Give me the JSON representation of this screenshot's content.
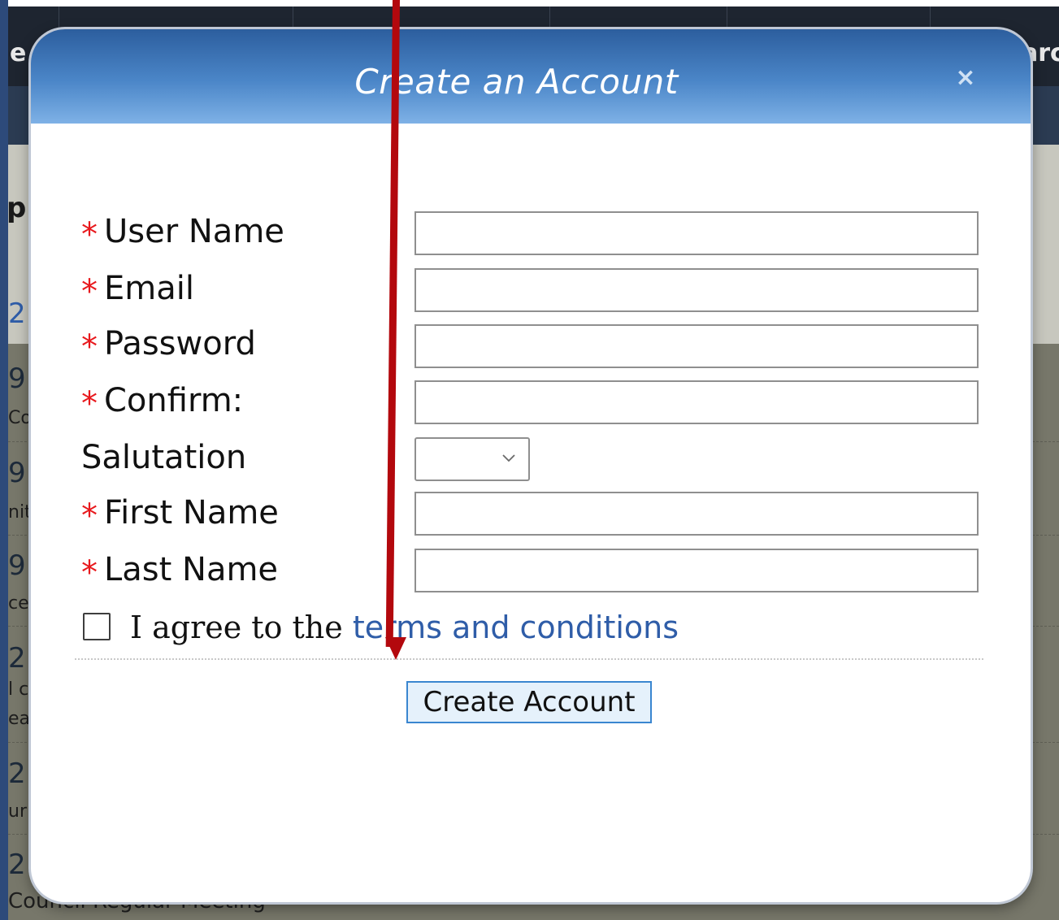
{
  "background": {
    "topbar_text_left": "e",
    "topbar_text_right": "arc",
    "side_chars": [
      "p",
      "2",
      "9",
      "9",
      "9",
      "2",
      "2",
      "2"
    ],
    "side_small": [
      "Co",
      "nit",
      "ce",
      "l c",
      "ea",
      "ur"
    ],
    "footer_text": "Council   Regular Meeting"
  },
  "modal": {
    "title": "Create an Account",
    "close_label": "×",
    "fields": [
      {
        "label": "User Name",
        "required": true,
        "value": ""
      },
      {
        "label": "Email",
        "required": true,
        "value": ""
      },
      {
        "label": "Password",
        "required": true,
        "value": ""
      },
      {
        "label": "Confirm:",
        "required": true,
        "value": ""
      }
    ],
    "salutation": {
      "label": "Salutation",
      "value": "",
      "chevron": "chevron-down-icon"
    },
    "name_fields": [
      {
        "label": "First Name",
        "required": true,
        "value": ""
      },
      {
        "label": "Last Name",
        "required": true,
        "value": ""
      }
    ],
    "required_marker": "*",
    "agree": {
      "prefix": "I agree to the ",
      "link_text": "terms and conditions",
      "checked": false
    },
    "submit_label": "Create Account"
  },
  "annotation": {
    "color": "#b3080d",
    "type": "arrow"
  },
  "colors": {
    "required": "#e8191d",
    "link": "#2f5da8",
    "header_top": "#2c5e9e",
    "header_bottom": "#7eb1e6"
  }
}
